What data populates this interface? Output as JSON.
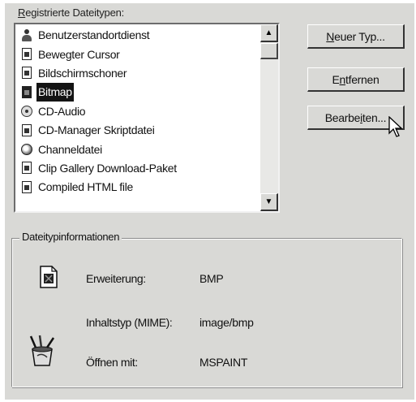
{
  "dialog": {
    "registered_types_label_underlined": "R",
    "registered_types_label_rest": "egistrierte Dateitypen:"
  },
  "file_types": [
    {
      "label": "Benutzerstandortdienst",
      "icon": "person-icon",
      "selected": false
    },
    {
      "label": "Bewegter Cursor",
      "icon": "document-icon",
      "selected": false
    },
    {
      "label": "Bildschirmschoner",
      "icon": "document-icon",
      "selected": false
    },
    {
      "label": "Bitmap",
      "icon": "bitmap-icon",
      "selected": true
    },
    {
      "label": "CD-Audio",
      "icon": "cd-icon",
      "selected": false
    },
    {
      "label": "CD-Manager Skriptdatei",
      "icon": "cd-script-icon",
      "selected": false
    },
    {
      "label": "Channeldatei",
      "icon": "globe-icon",
      "selected": false
    },
    {
      "label": "Clip Gallery Download-Paket",
      "icon": "document-icon",
      "selected": false
    },
    {
      "label": "Compiled HTML file",
      "icon": "document-icon",
      "selected": false
    }
  ],
  "buttons": {
    "new_type_underlined": "N",
    "new_type_rest": "euer Typ...",
    "remove_pre": "E",
    "remove_underlined": "n",
    "remove_rest": "tfernen",
    "edit_pre": "Bearbe",
    "edit_underlined": "i",
    "edit_rest": "ten..."
  },
  "info": {
    "group_title": "Dateitypinformationen",
    "extension_label": "Erweiterung:",
    "extension_value": "BMP",
    "content_type_label": "Inhaltstyp (MIME):",
    "content_type_value": "image/bmp",
    "open_with_label": "Öffnen mit:",
    "open_with_value": "MSPAINT"
  },
  "colors": {
    "panel": "#d9d9d6",
    "selection": "#141414"
  }
}
